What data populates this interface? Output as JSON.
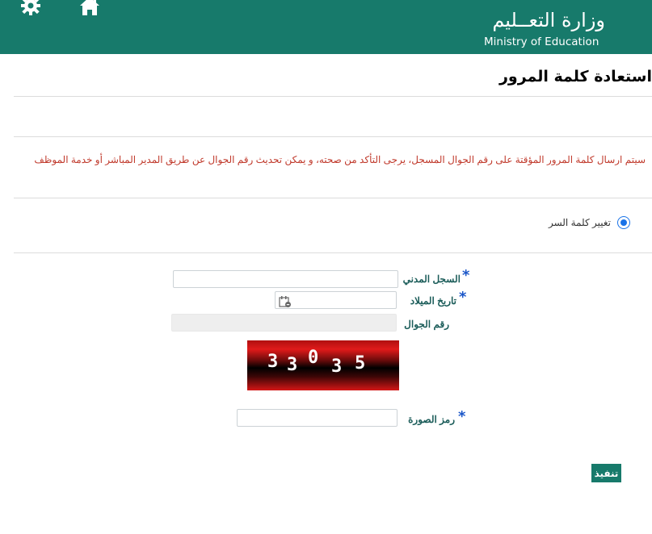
{
  "header": {
    "logo_ar": "وزارة التعــليم",
    "logo_en": "Ministry of Education"
  },
  "page_title": "استعادة كلمة المرور",
  "notice": "سيتم ارسال كلمة المرور المؤقتة على رقم الجوال المسجل، يرجى التأكد من صحته، و يمكن تحديث رقم الجوال عن طريق المدير المباشر أو خدمة الموظف",
  "option": {
    "label": "تغيير كلمة السر",
    "selected": true
  },
  "form": {
    "civil_id_label": "السجل المدني",
    "birth_date_label": "تاريخ الميلاد",
    "mobile_label": "رقم الجوال",
    "captcha_code_label": "رمز الصورة",
    "required_mark": "*",
    "civil_id_value": "",
    "birth_date_value": "",
    "mobile_value": "",
    "captcha_code_value": ""
  },
  "captcha": {
    "digits": [
      "3",
      "3",
      "0",
      "3",
      "5"
    ]
  },
  "submit_label": "تنفيذ",
  "colors": {
    "brand": "#177a6b",
    "notice": "#c0392b",
    "label": "#1c5d5a",
    "required": "#1a56c8"
  },
  "icons": {
    "settings": "gear-icon",
    "home": "home-icon",
    "calendar": "calendar-icon"
  }
}
